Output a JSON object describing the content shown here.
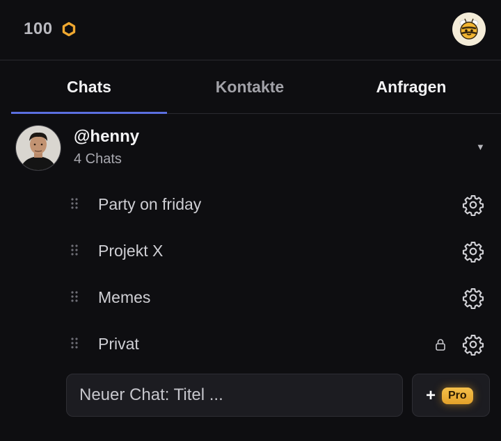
{
  "header": {
    "coin_count": "100",
    "coin_icon": "hexagon-coin-icon",
    "coin_color": "#f0a830",
    "profile_icon": "bee-icon"
  },
  "tabs": [
    {
      "label": "Chats",
      "active": true
    },
    {
      "label": "Kontakte",
      "active": false
    },
    {
      "label": "Anfragen",
      "active": false
    }
  ],
  "accent_color": "#5b6fe0",
  "user": {
    "handle": "@henny",
    "chat_count": "4 Chats",
    "expand_icon": "caret-down-icon"
  },
  "chats": [
    {
      "title": "Party on friday",
      "locked": false
    },
    {
      "title": "Projekt X",
      "locked": false
    },
    {
      "title": "Memes",
      "locked": false
    },
    {
      "title": "Privat",
      "locked": true
    }
  ],
  "composer": {
    "placeholder": "Neuer Chat: Titel ...",
    "plus_label": "+",
    "pro_label": "Pro"
  }
}
